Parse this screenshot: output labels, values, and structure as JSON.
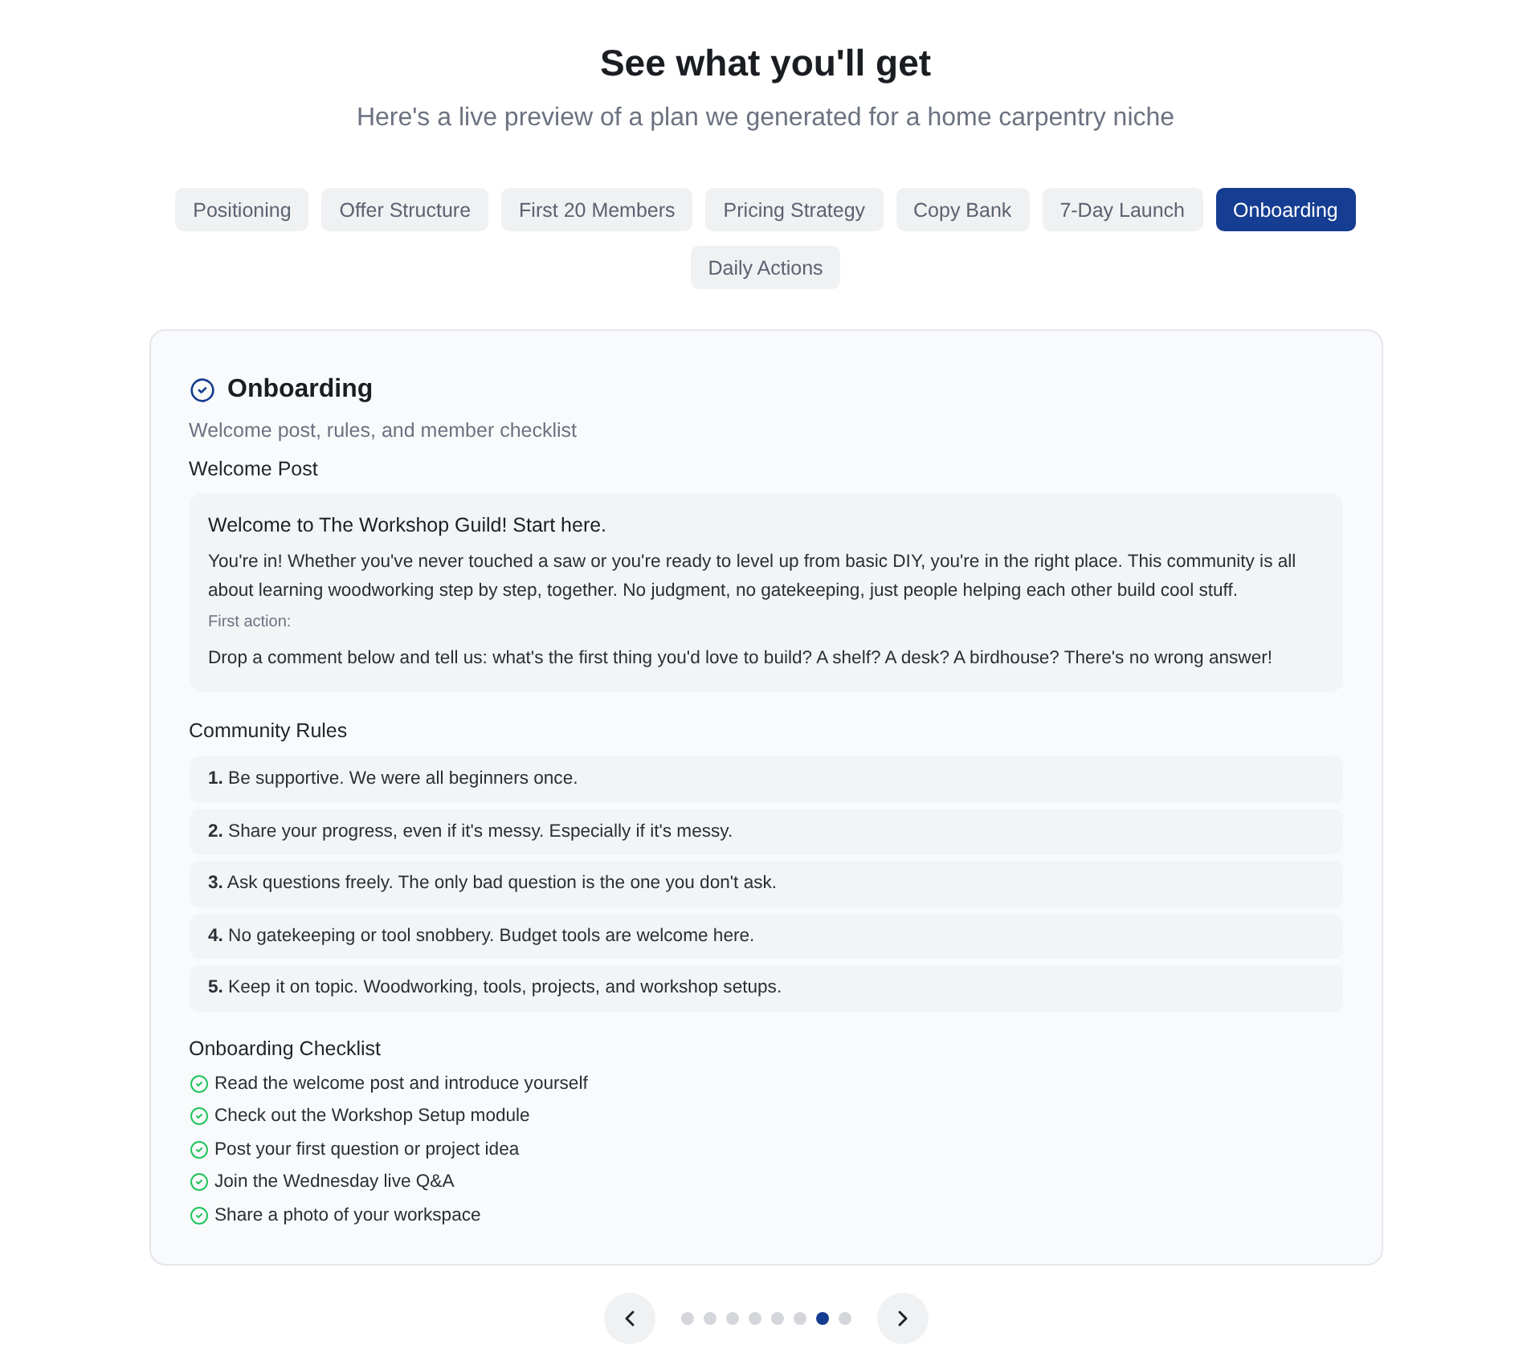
{
  "header": {
    "title": "See what you'll get",
    "subtitle": "Here's a live preview of a plan we generated for a home carpentry niche"
  },
  "tabs": [
    {
      "label": "Positioning",
      "selected": false
    },
    {
      "label": "Offer Structure",
      "selected": false
    },
    {
      "label": "First 20 Members",
      "selected": false
    },
    {
      "label": "Pricing Strategy",
      "selected": false
    },
    {
      "label": "Copy Bank",
      "selected": false
    },
    {
      "label": "7-Day Launch",
      "selected": false
    },
    {
      "label": "Onboarding",
      "selected": true
    },
    {
      "label": "Daily Actions",
      "selected": false
    }
  ],
  "panel": {
    "title": "Onboarding",
    "subtitle": "Welcome post, rules, and member checklist",
    "welcome_post": {
      "heading": "Welcome Post",
      "title": "Welcome to The Workshop Guild! Start here.",
      "body": "You're in! Whether you've never touched a saw or you're ready to level up from basic DIY, you're in the right place. This community is all about learning woodworking step by step, together. No judgment, no gatekeeping, just people helping each other build cool stuff.",
      "first_action_label": "First action:",
      "first_action": "Drop a comment below and tell us: what's the first thing you'd love to build? A shelf? A desk? A birdhouse? There's no wrong answer!"
    },
    "rules": {
      "heading": "Community Rules",
      "items": [
        "**1.** Be supportive. We were all beginners once.",
        "**2.** Share your progress, even if it's messy. Especially if it's messy.",
        "**3.** Ask questions freely. The only bad question is the one you don't ask.",
        "**4.** No gatekeeping or tool snobbery. Budget tools are welcome here.",
        "**5.** Keep it on topic. Woodworking, tools, projects, and workshop setups."
      ]
    },
    "checklist": {
      "heading": "Onboarding Checklist",
      "items": [
        "Read the welcome post and introduce yourself",
        "Check out the Workshop Setup module",
        "Post your first question or project idea",
        "Join the Wednesday live Q&A",
        "Share a photo of your workspace"
      ]
    }
  },
  "pagination": {
    "dots": [
      {
        "selected": false
      },
      {
        "selected": false
      },
      {
        "selected": false
      },
      {
        "selected": false
      },
      {
        "selected": false
      },
      {
        "selected": false
      },
      {
        "selected": true
      },
      {
        "selected": false
      }
    ]
  }
}
